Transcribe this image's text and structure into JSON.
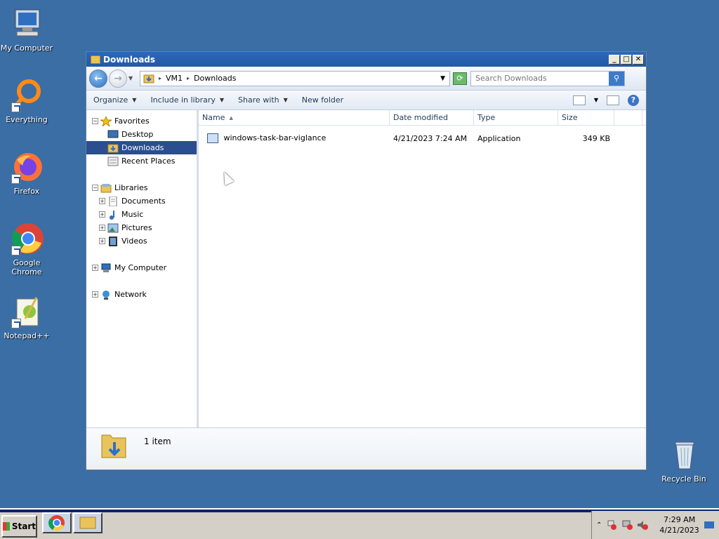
{
  "desktop": {
    "icons": [
      {
        "label": "My Computer"
      },
      {
        "label": "Everything"
      },
      {
        "label": "Firefox"
      },
      {
        "label": "Google Chrome"
      },
      {
        "label": "Notepad++"
      },
      {
        "label": "Recycle Bin"
      }
    ]
  },
  "window": {
    "title": "Downloads",
    "controls": {
      "minimize": "_",
      "maximize": "□",
      "close": "✕"
    }
  },
  "address": {
    "crumbs": [
      "VM1",
      "Downloads"
    ],
    "search_placeholder": "Search Downloads"
  },
  "toolbar": {
    "organize": "Organize",
    "include_in_library": "Include in library",
    "share_with": "Share with",
    "new_folder": "New folder",
    "help": "?"
  },
  "navpane": {
    "favorites": "Favorites",
    "desktop": "Desktop",
    "downloads": "Downloads",
    "recent_places": "Recent Places",
    "libraries": "Libraries",
    "documents": "Documents",
    "music": "Music",
    "pictures": "Pictures",
    "videos": "Videos",
    "my_computer": "My Computer",
    "network": "Network"
  },
  "columns": {
    "name": "Name",
    "date_modified": "Date modified",
    "type": "Type",
    "size": "Size"
  },
  "files": [
    {
      "name": "windows-task-bar-viglance",
      "date_modified": "4/21/2023 7:24 AM",
      "type": "Application",
      "size": "349 KB"
    }
  ],
  "details": {
    "count": "1 item"
  },
  "taskbar": {
    "start": "Start",
    "time": "7:29 AM",
    "date": "4/21/2023"
  },
  "colors": {
    "desktop": "#3a6ea5",
    "selection": "#2a4e8f",
    "titlebar": "#2f67b8"
  }
}
